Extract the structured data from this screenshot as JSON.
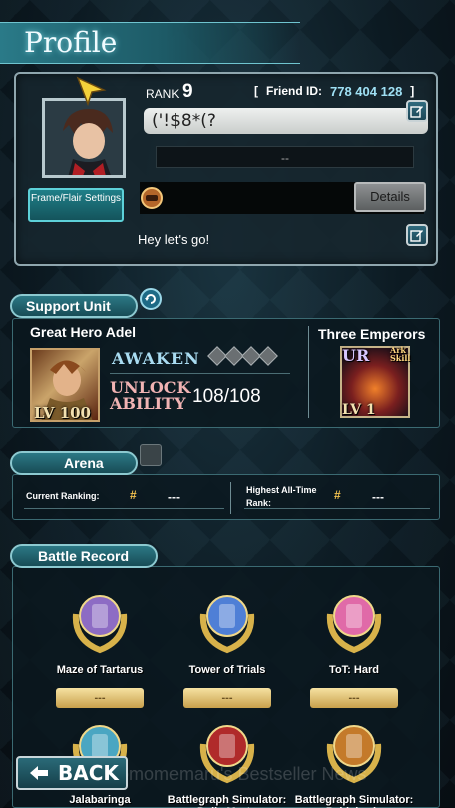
{
  "header": {
    "title": "Profile"
  },
  "profile": {
    "rank_label": "RANK",
    "rank_value": "9",
    "friend_bracket_open": "[",
    "friend_label": "Friend ID:",
    "friend_id": "778 404 128",
    "friend_bracket_close": "]",
    "name": "('!$8*(?",
    "title_value": "--",
    "frame_button": "Frame/Flair Settings",
    "details_button": "Details",
    "message": "Hey let's go!"
  },
  "support_unit": {
    "section_label": "Support Unit",
    "unit_name": "Great Hero Adel",
    "unit_level_prefix": "LV",
    "unit_level": "100",
    "awaken_label": "AWAKEN",
    "unlock_label_1": "UNLOCK",
    "unlock_label_2": "ABILITY",
    "unlock_value": "108/108",
    "esper_name": "Three Emperors",
    "esper_rarity": "UR",
    "esper_tag": "Ark Skill",
    "esper_level_prefix": "LV",
    "esper_level": "1"
  },
  "arena": {
    "section_label": "Arena",
    "current_ranking_label": "Current Ranking:",
    "current_ranking_value": "---",
    "highest_label": "Highest All-Time Rank:",
    "highest_value": "---"
  },
  "battle_record": {
    "section_label": "Battle Record",
    "items": [
      {
        "name": "Maze of Tartarus",
        "value": "---",
        "color": "#8d6cc4"
      },
      {
        "name": "Tower of Trials",
        "value": "---",
        "color": "#4f7fd6"
      },
      {
        "name": "ToT: Hard",
        "value": "---",
        "color": "#e06aa8"
      },
      {
        "name": "Jalabaringa",
        "value": "",
        "color": "#4aa6c2"
      },
      {
        "name": "Battlegraph Simulator: Della Mortu",
        "value": "",
        "color": "#b02a2a"
      },
      {
        "name": "Battlegraph Simulator: Pablaboria",
        "value": "",
        "color": "#c47a2a"
      }
    ]
  },
  "footer": {
    "back_label": "BACK",
    "watermark": "Tomomemaru's Bestseller News"
  }
}
